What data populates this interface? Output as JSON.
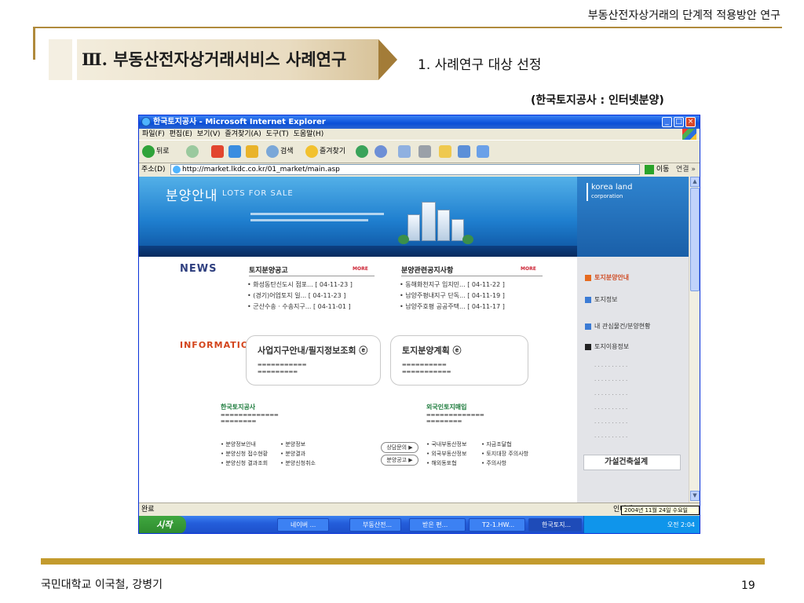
{
  "slide": {
    "doc_title": "부동산전자상거래의 단계적 적용방안 연구",
    "section_title": "Ⅲ. 부동산전자상거래서비스 사례연구",
    "sub_heading": "1. 사례연구 대상 선정",
    "source_note": "(한국토지공사 : 인터넷분양)",
    "footer_authors": "국민대학교 이국철, 강병기",
    "page_number": "19",
    "accent_color": "#b08a3c"
  },
  "browser": {
    "window_title": "한국토지공사 - Microsoft Internet Explorer",
    "menu": [
      "파일(F)",
      "편집(E)",
      "보기(V)",
      "즐겨찾기(A)",
      "도구(T)",
      "도움말(H)"
    ],
    "toolbar": {
      "back": "뒤로",
      "search": "검색",
      "favorites": "즐겨찾기"
    },
    "address_label": "주소(D)",
    "address_url": "http://market.lkdc.co.kr/01_market/main.asp",
    "go_label": "이동",
    "links_label": "연결 »",
    "status_text": "완료",
    "status_zone": "인터넷",
    "date_tooltip": "2004년 11월 24일 수요일"
  },
  "webpage": {
    "hero_title": "분양안내",
    "hero_subtitle": "LOTS FOR SALE",
    "logo_text_1": "korea land",
    "logo_text_2": "corporation",
    "news_label": "NEWS",
    "info_label": "INFORMATION",
    "news_col1_title": "토지분양공고",
    "news_col2_title": "분양관련공지사항",
    "more": "MORE",
    "news_col1": [
      {
        "title": "• 화성동탄신도시 점포...",
        "date": "[ 04-11-23 ]"
      },
      {
        "title": "• (경기)어업토지 일...",
        "date": "[ 04-11-23 ]"
      },
      {
        "title": "• 군산수송 · 수송지구...",
        "date": "[ 04-11-01 ]"
      }
    ],
    "news_col2": [
      {
        "title": "• 동해화천지구 입지민...",
        "date": "[ 04-11-22 ]"
      },
      {
        "title": "• 남양주평내지구 단독...",
        "date": "[ 04-11-19 ]"
      },
      {
        "title": "• 남양주호평 공공주택...",
        "date": "[ 04-11-17 ]"
      }
    ],
    "info_box1_title": "사업지구안내/필지정보조회 ⓔ",
    "info_box2_title": "토지분양계획 ⓔ",
    "right_menu": [
      "토지분양안내",
      "토지정보",
      "내 관심물건/분양현황",
      "토지이용정보"
    ],
    "right_box": "가설건축설계",
    "bottom_left_head": "한국토지공사",
    "bottom_right_head": "외국인토지매입",
    "bottom_left_links": [
      "• 분양정보안내",
      "• 분양신청 접수현황",
      "• 분양신청 결과조회",
      "• 분양정보",
      "• 분양결과",
      "• 분양신청취소"
    ],
    "bottom_right_links": [
      "• 국내부동산정보",
      "• 외국부동산정보",
      "• 해외동포협",
      "• 자금조달협",
      "• 토지대장 주의사항",
      "• 주의사항"
    ],
    "bubble1": "상담문의 ▶",
    "bubble2": "분양공고 ▶"
  },
  "taskbar": {
    "start": "시작",
    "tasks": [
      "네이버 ...",
      "부동산전...",
      "받은 편...",
      "T2-1.HW...",
      "한국토지..."
    ],
    "clock": "오전 2:04"
  }
}
